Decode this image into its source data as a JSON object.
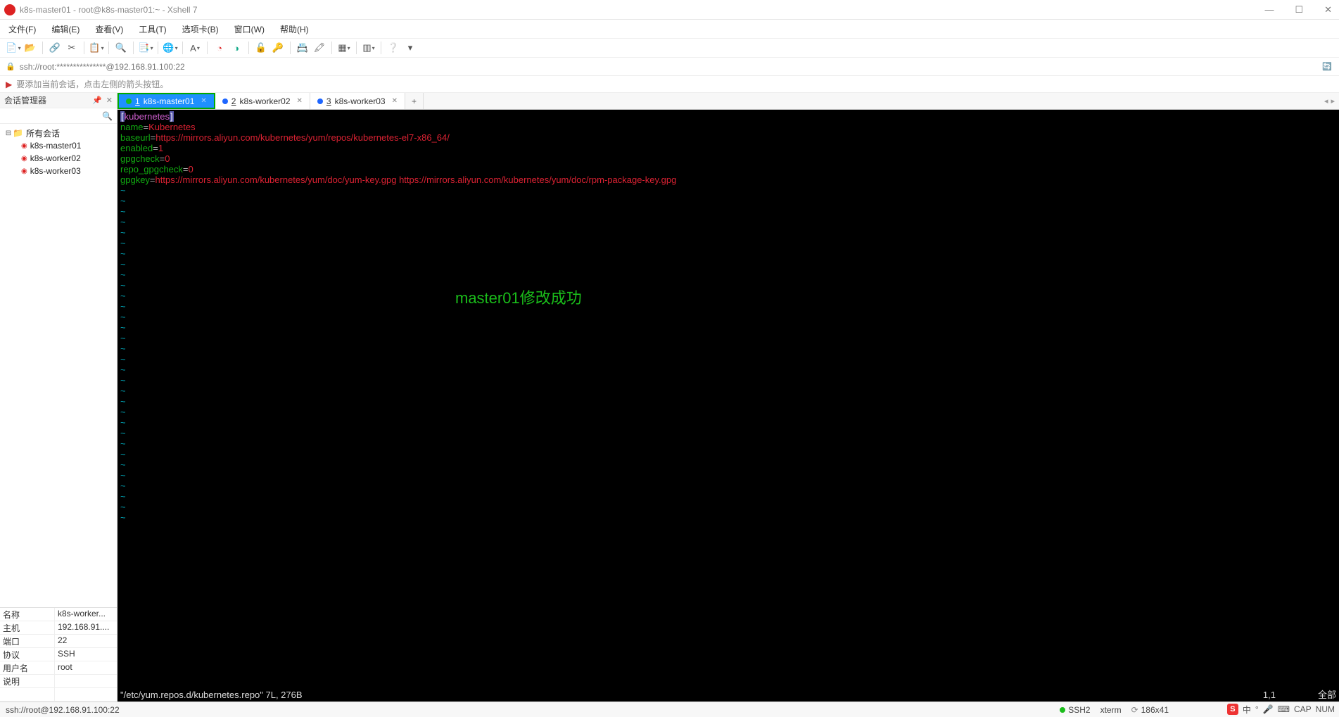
{
  "window": {
    "title": "k8s-master01 - root@k8s-master01:~ - Xshell 7"
  },
  "menus": {
    "file": "文件(F)",
    "edit": "编辑(E)",
    "view": "查看(V)",
    "tools": "工具(T)",
    "tabs": "选项卡(B)",
    "window": "窗口(W)",
    "help": "帮助(H)"
  },
  "address": {
    "url": "ssh://root:***************@192.168.91.100:22"
  },
  "hint": {
    "text": "要添加当前会话，点击左侧的箭头按钮。"
  },
  "sidebar": {
    "title": "会话管理器",
    "root": "所有会话",
    "items": [
      {
        "label": "k8s-master01"
      },
      {
        "label": "k8s-worker02"
      },
      {
        "label": "k8s-worker03"
      }
    ],
    "props": {
      "name_k": "名称",
      "name_v": "k8s-worker...",
      "host_k": "主机",
      "host_v": "192.168.91....",
      "port_k": "端口",
      "port_v": "22",
      "proto_k": "协议",
      "proto_v": "SSH",
      "user_k": "用户名",
      "user_v": "root",
      "desc_k": "说明",
      "desc_v": ""
    }
  },
  "tabs": {
    "items": [
      {
        "num": "1",
        "label": "k8s-master01",
        "active": true,
        "dot": "green"
      },
      {
        "num": "2",
        "label": "k8s-worker02",
        "active": false,
        "dot": "blue"
      },
      {
        "num": "3",
        "label": "k8s-worker03",
        "active": false,
        "dot": "blue"
      }
    ]
  },
  "terminal": {
    "section": "kubernetes",
    "lines": {
      "name_k": "name",
      "name_v": "Kubernetes",
      "baseurl_k": "baseurl",
      "baseurl_v": "https://mirrors.aliyun.com/kubernetes/yum/repos/kubernetes-el7-x86_64/",
      "enabled_k": "enabled",
      "enabled_v": "1",
      "gpgcheck_k": "gpgcheck",
      "gpgcheck_v": "0",
      "repo_gpgcheck_k": "repo_gpgcheck",
      "repo_gpgcheck_v": "0",
      "gpgkey_k": "gpgkey",
      "gpgkey_v": "https://mirrors.aliyun.com/kubernetes/yum/doc/yum-key.gpg https://mirrors.aliyun.com/kubernetes/yum/doc/rpm-package-key.gpg"
    },
    "status_file": "\"/etc/yum.repos.d/kubernetes.repo\" 7L, 276B",
    "status_pos": "1,1",
    "status_mode": "全部",
    "overlay": "master01修改成功"
  },
  "statusbar": {
    "conn": "ssh://root@192.168.91.100:22",
    "ssh": "SSH2",
    "term": "xterm",
    "size": "186x41",
    "ime_zhong": "中",
    "caps": "CAP",
    "extra": "NUM"
  }
}
